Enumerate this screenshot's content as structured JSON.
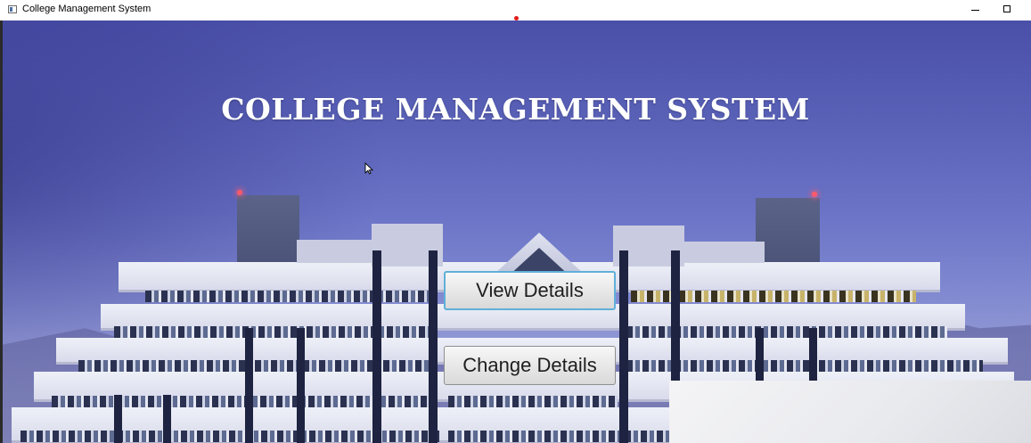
{
  "window": {
    "title": "College Management System",
    "icon": "app-window-icon",
    "controls": [
      "minimize-icon",
      "maximize-icon"
    ]
  },
  "main": {
    "heading": "COLLEGE MANAGEMENT SYSTEM",
    "buttons": {
      "view": "View Details",
      "change": "Change Details"
    }
  },
  "colors": {
    "sky_top": "#4a4fa8",
    "sky_bottom": "#9a9fd4",
    "focus_border": "#5fb0d8",
    "title_text": "#ffffff"
  }
}
